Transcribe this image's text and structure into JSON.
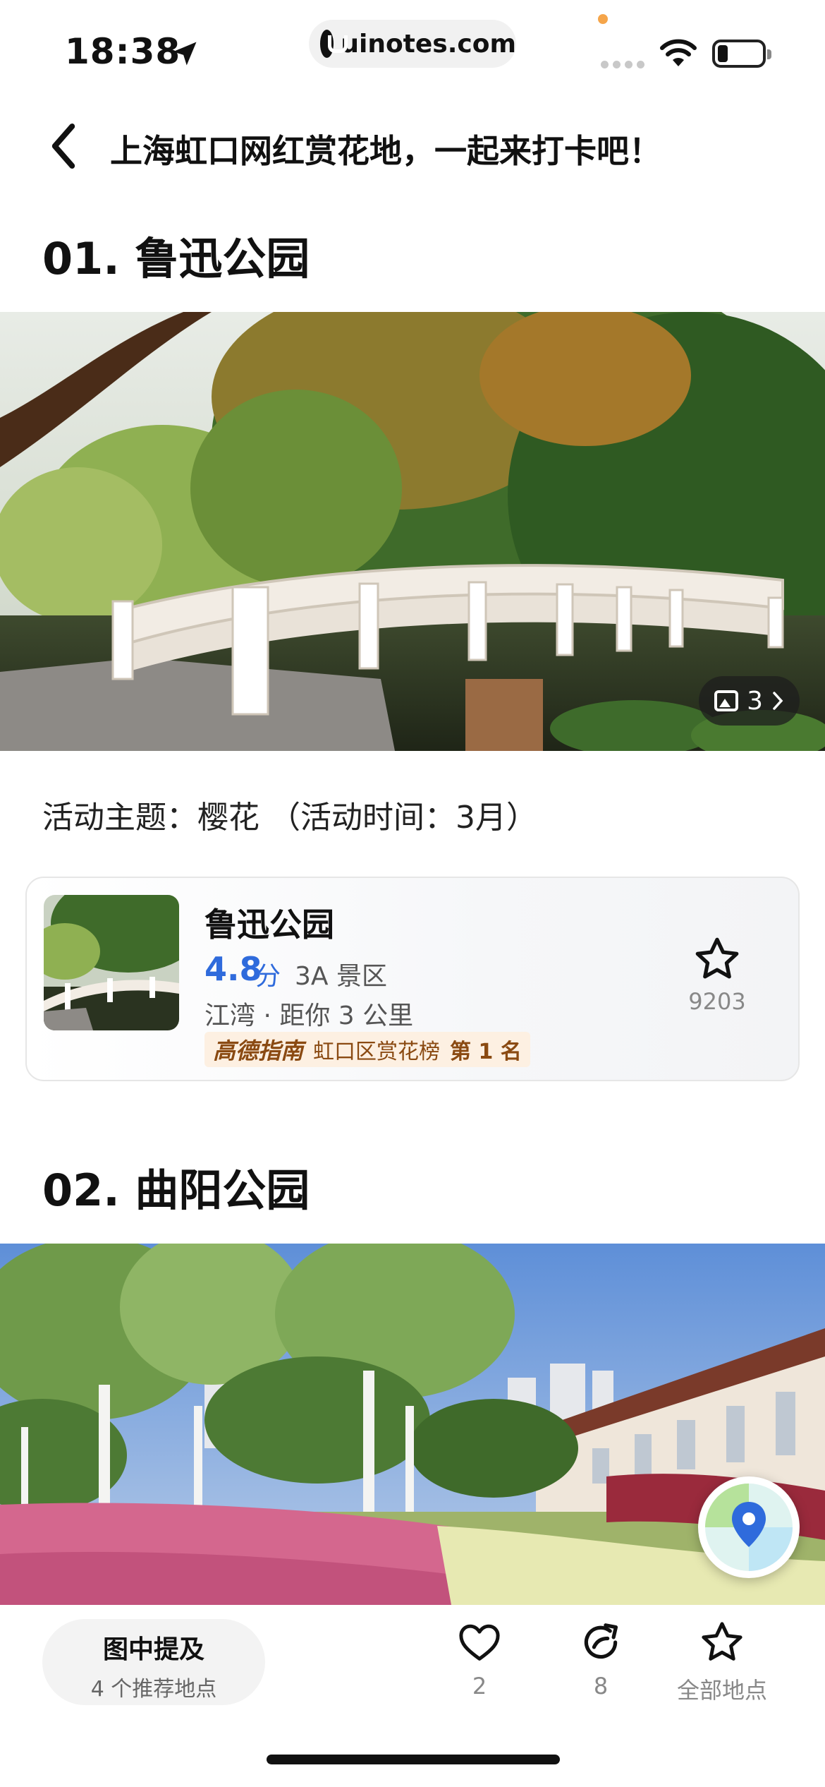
{
  "status_bar": {
    "time": "18:38",
    "url": "uinotes.com"
  },
  "header": {
    "title": "上海虹口网红赏花地，一起来打卡吧！"
  },
  "sections": [
    {
      "title": "01. 鲁迅公园",
      "photo_count": "3",
      "theme": "活动主题：樱花 （活动时间：3月）",
      "poi": {
        "name": "鲁迅公园",
        "score": "4.8",
        "score_unit": "分",
        "level": "3A 景区",
        "distance": "江湾 · 距你 3 公里",
        "rank_brand": "高德指南",
        "rank_list": "虹口区赏花榜",
        "rank_position": "第 1 名",
        "fav_count": "9203"
      }
    },
    {
      "title": "02. 曲阳公园"
    }
  ],
  "bottom_bar": {
    "mention_title": "图中提及",
    "mention_sub": "4 个推荐地点",
    "like_count": "2",
    "share_count": "8",
    "all_places_label": "全部地点"
  },
  "icons": {
    "back": "chevron-left-icon",
    "location": "location-arrow-icon",
    "wifi": "wifi-icon",
    "battery": "battery-icon",
    "photos": "image-icon",
    "star": "star-icon",
    "heart": "heart-icon",
    "share": "share-icon",
    "map": "map-pin-icon"
  },
  "colors": {
    "score_blue": "#2f6bdc",
    "rank_brown": "#8a4a12",
    "rank_bg": "#fdf0e2"
  }
}
